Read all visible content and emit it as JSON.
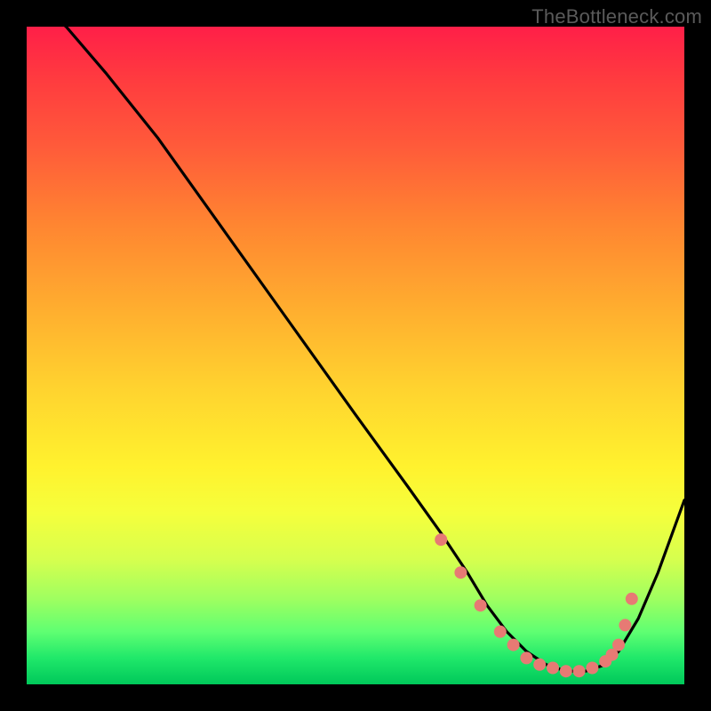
{
  "watermark": "TheBottleneck.com",
  "chart_data": {
    "type": "line",
    "title": "",
    "xlabel": "",
    "ylabel": "",
    "xlim": [
      0,
      100
    ],
    "ylim": [
      0,
      100
    ],
    "series": [
      {
        "name": "curve",
        "x": [
          0,
          6,
          12,
          20,
          30,
          40,
          50,
          58,
          63,
          67,
          70,
          73,
          76,
          79,
          82,
          85,
          88,
          90,
          93,
          96,
          100
        ],
        "y": [
          105,
          100,
          93,
          83,
          69,
          55,
          41,
          30,
          23,
          17,
          12,
          8,
          5,
          3,
          2,
          2,
          3,
          5,
          10,
          17,
          28
        ]
      }
    ],
    "markers": {
      "name": "dots",
      "x": [
        63,
        66,
        69,
        72,
        74,
        76,
        78,
        80,
        82,
        84,
        86,
        88,
        89,
        90,
        91,
        92
      ],
      "y": [
        22,
        17,
        12,
        8,
        6,
        4,
        3,
        2.5,
        2,
        2,
        2.5,
        3.5,
        4.5,
        6,
        9,
        13
      ],
      "color": "#e77a74",
      "radius": 7
    },
    "background": {
      "type": "vertical-gradient",
      "stops": [
        "#ff1f48",
        "#ffd32f",
        "#fff22e",
        "#00c85a"
      ]
    }
  }
}
